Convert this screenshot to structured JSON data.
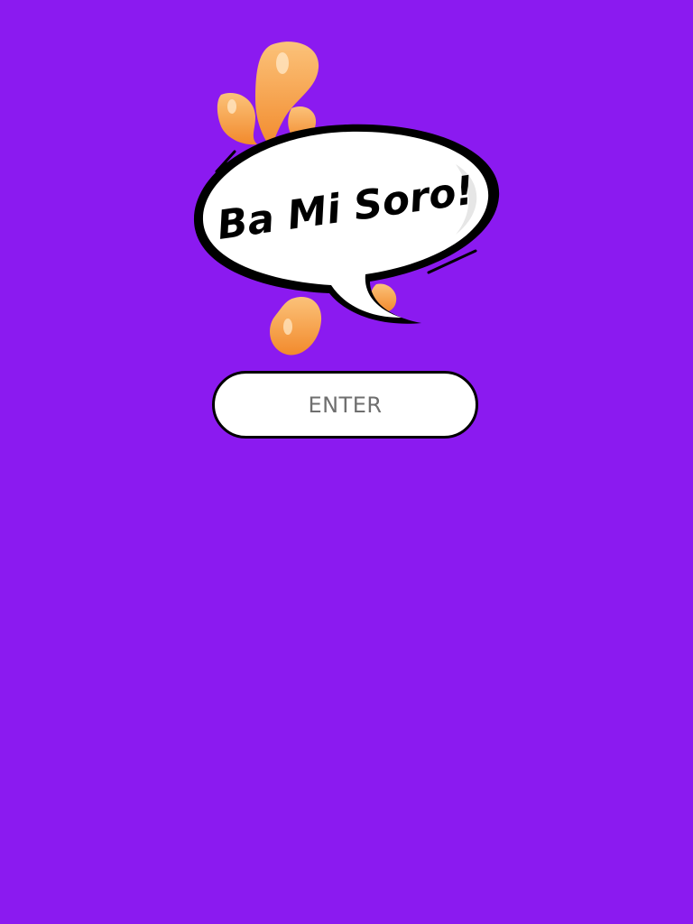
{
  "logo": {
    "text": "Ba Mi Soro!",
    "icon": "speech-bubble-logo"
  },
  "enter_button": {
    "label": "ENTER"
  },
  "colors": {
    "background": "#8b1af0",
    "splash": "#f6a24a",
    "bubble": "#ffffff",
    "outline": "#000000",
    "button_text": "#6f6f6f"
  }
}
